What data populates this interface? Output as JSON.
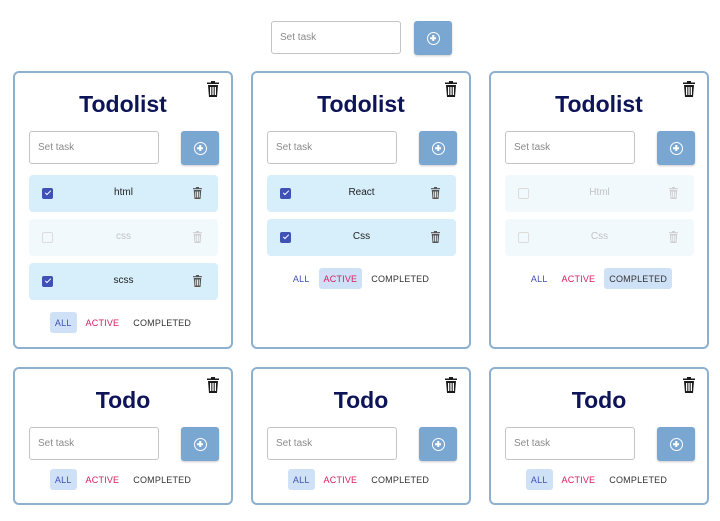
{
  "top": {
    "placeholder": "Set task"
  },
  "cards": [
    {
      "title": "Todolist",
      "placeholder": "Set task",
      "filter": "all",
      "tasks": [
        {
          "text": "html",
          "checked": true,
          "faded": false
        },
        {
          "text": "css",
          "checked": false,
          "faded": true
        },
        {
          "text": "scss",
          "checked": true,
          "faded": false
        }
      ]
    },
    {
      "title": "Todolist",
      "placeholder": "Set task",
      "filter": "active",
      "tasks": [
        {
          "text": "React",
          "checked": true,
          "faded": false
        },
        {
          "text": "Css",
          "checked": true,
          "faded": false
        }
      ]
    },
    {
      "title": "Todolist",
      "placeholder": "Set task",
      "filter": "completed",
      "tasks": [
        {
          "text": "Html",
          "checked": false,
          "faded": true
        },
        {
          "text": "Css",
          "checked": false,
          "faded": true
        }
      ]
    },
    {
      "title": "Todo",
      "placeholder": "Set task",
      "filter": "all",
      "tasks": []
    },
    {
      "title": "Todo",
      "placeholder": "Set task",
      "filter": "all",
      "tasks": []
    },
    {
      "title": "Todo",
      "placeholder": "Set task",
      "filter": "all",
      "tasks": []
    }
  ],
  "filters": {
    "all": "ALL",
    "active": "ACTIVE",
    "completed": "COMPLETED"
  },
  "colors": {
    "accent": "#7aa6d2",
    "title": "#0d1457",
    "row_bg": "#d7eefb",
    "checkbox": "#3f51b5",
    "filter_all": "#3f51b5",
    "filter_active": "#d81b60",
    "filter_selected_bg": "#cfe1f7",
    "card_border": "#8eb0cf"
  },
  "icons": {
    "add": "plus-circle-icon",
    "delete_card": "trash-icon",
    "delete_task": "trash-icon",
    "checkbox": "check-icon"
  }
}
